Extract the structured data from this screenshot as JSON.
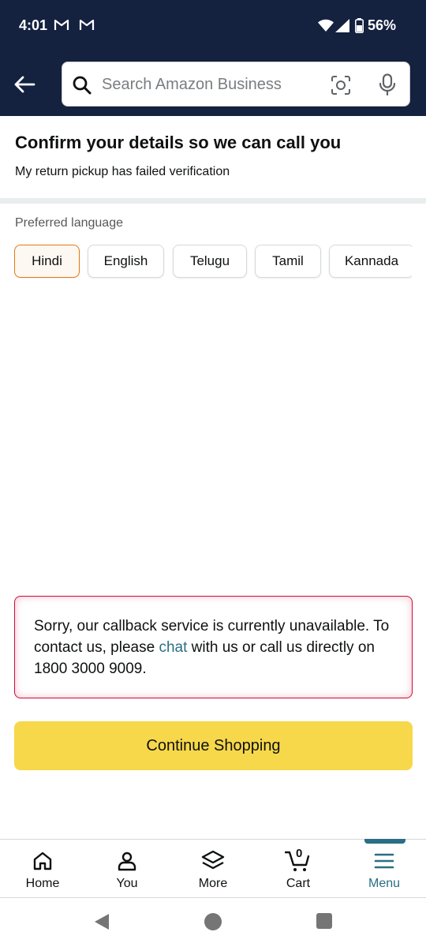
{
  "status_bar": {
    "time": "4:01",
    "battery": "56%"
  },
  "search": {
    "placeholder": "Search Amazon Business"
  },
  "page": {
    "title": "Confirm your details so we can call you",
    "subtitle": "My return pickup has failed verification"
  },
  "language": {
    "label": "Preferred language",
    "options": [
      "Hindi",
      "English",
      "Telugu",
      "Tamil",
      "Kannada"
    ],
    "selected": "Hindi"
  },
  "alert": {
    "line_before_link": "Sorry, our callback service is currently unavailable. To contact us, please ",
    "link_text": "chat",
    "line_after_link": " with us or call us directly on 1800 3000 9009."
  },
  "cta": {
    "label": "Continue Shopping"
  },
  "bottom_nav": {
    "items": [
      {
        "label": "Home",
        "icon": "home-icon"
      },
      {
        "label": "You",
        "icon": "person-icon"
      },
      {
        "label": "More",
        "icon": "layers-icon"
      },
      {
        "label": "Cart",
        "icon": "cart-icon",
        "count": "0"
      },
      {
        "label": "Menu",
        "icon": "menu-icon",
        "active": true
      }
    ]
  },
  "colors": {
    "header": "#14213f",
    "accent_teal": "#2a6f83",
    "cta_yellow": "#f7d84a",
    "alert_red": "#cc0c39",
    "selected_chip": "#e47911"
  }
}
